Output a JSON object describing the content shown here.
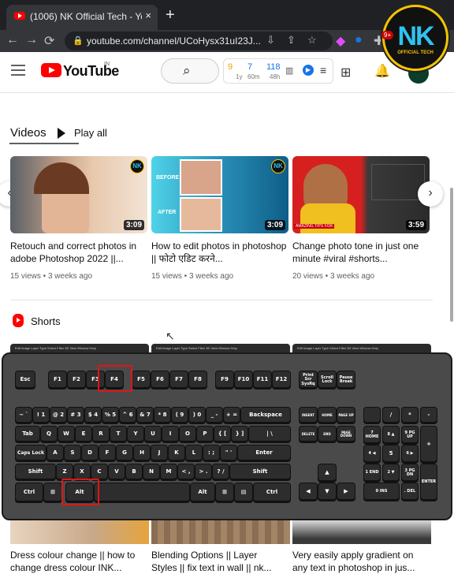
{
  "browser": {
    "tab_title": "(1006) NK Official Tech - YouTube",
    "tab_close": "×",
    "new_tab": "+",
    "url": "youtube.com/channel/UCoHysx31uI23J...",
    "nav_back": "←",
    "nav_forward": "→",
    "nav_reload": "⟳",
    "lock": "🔒"
  },
  "channel_badge": {
    "letters": "NK",
    "subtitle": "OFFICIAL TECH",
    "notif": "9+"
  },
  "youtube": {
    "logo_text": "YouTube",
    "country": "IN",
    "search_icon": "search-icon",
    "stats": {
      "a": "9",
      "b": "7",
      "c": "118",
      "a_sub": "1y",
      "b_sub": "60m",
      "c_sub": "48h"
    }
  },
  "videos": {
    "section_title": "Videos",
    "play_all": "Play all",
    "items": [
      {
        "title": "Retouch and correct photos in adobe Photoshop 2022 ||...",
        "meta": "15 views • 3 weeks ago",
        "duration": "3:09"
      },
      {
        "title": "How to edit photos in photoshop || फोटो एडिट करने...",
        "meta": "15 views • 3 weeks ago",
        "duration": "3:09"
      },
      {
        "title": "Change photo tone in just one minute #viral #shorts...",
        "meta": "20 views • 3 weeks ago",
        "duration": "3:59"
      }
    ],
    "thumb_labels": [
      "BEFORE",
      "AFTER",
      "AMAZING TIPS FOR"
    ]
  },
  "shorts": {
    "section_title": "Shorts",
    "menu_strip": "Edit  Image  Layer  Type  Select  Filter  3D  View  Window  Help",
    "items": [
      {
        "title": "Dress colour change || how to change dress colour INK..."
      },
      {
        "title": "Blending Options || Layer Styles || fix text in wall || nk..."
      },
      {
        "title": "Very easily apply gradient on any text in photoshop in jus..."
      }
    ]
  },
  "keyboard": {
    "fn_row": [
      "Esc",
      "F1",
      "F2",
      "F3",
      "F4",
      "F5",
      "F6",
      "F7",
      "F8",
      "F9",
      "F10",
      "F11",
      "F12",
      "Print Scr SysRq",
      "Scroll Lock",
      "Pause Break"
    ],
    "num_row": [
      "~ `",
      "! 1",
      "@ 2",
      "# 3",
      "$ 4",
      "% 5",
      "^ 6",
      "& 7",
      "* 8",
      "( 9",
      ") 0",
      "_ -",
      "+ =",
      "Backspace"
    ],
    "q_row": [
      "Tab",
      "Q",
      "W",
      "E",
      "R",
      "T",
      "Y",
      "U",
      "I",
      "O",
      "P",
      "{ [",
      "} ]",
      "| \\"
    ],
    "a_row": [
      "Caps Lock",
      "A",
      "S",
      "D",
      "F",
      "G",
      "H",
      "J",
      "K",
      "L",
      ": ;",
      "\" '",
      "Enter"
    ],
    "z_row": [
      "Shift",
      "Z",
      "X",
      "C",
      "V",
      "B",
      "N",
      "M",
      "< ,",
      "> .",
      "? /",
      "Shift"
    ],
    "bottom_row": [
      "Ctrl",
      "⊞",
      "Alt",
      "",
      "Alt",
      "⊞",
      "▤",
      "Ctrl"
    ],
    "nav_cluster": [
      "INSERT",
      "HOME",
      "PAGE UP",
      "DELETE",
      "END",
      "PAGE DOWN"
    ],
    "arrows": [
      "▲",
      "◀",
      "▼",
      "▶"
    ],
    "numpad": [
      "",
      "/",
      "*",
      "-",
      "7 HOME",
      "8 ▲",
      "9 PG UP",
      "+",
      "4 ◀",
      "5",
      "6 ▶",
      "1 END",
      "2 ▼",
      "3 PG DN",
      "ENTER",
      "0 INS",
      ". DEL"
    ],
    "highlighted": [
      "F4",
      "Alt"
    ]
  }
}
